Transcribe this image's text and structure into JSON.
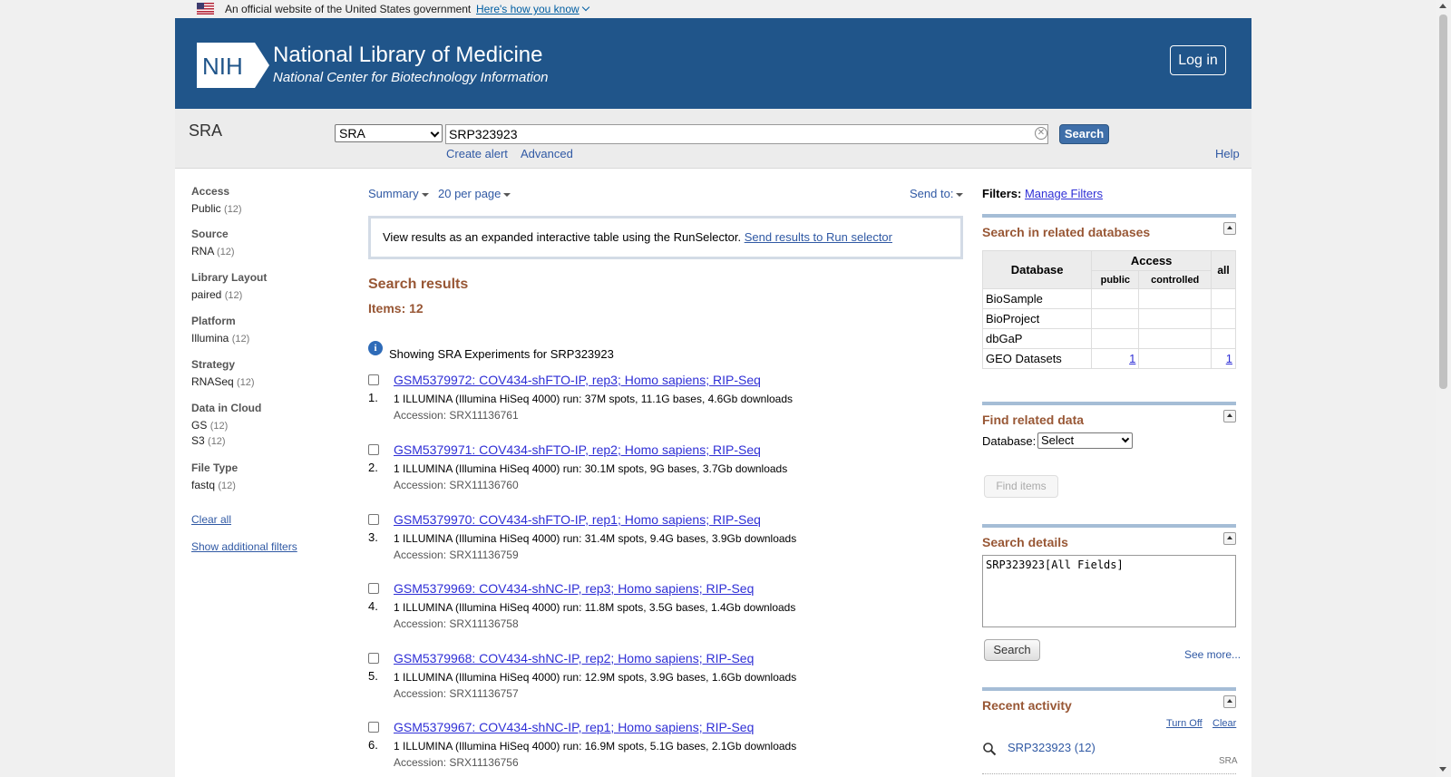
{
  "gov_banner": {
    "text": "An official website of the United States government",
    "link": "Here's how you know"
  },
  "header": {
    "logo_text": "NIH",
    "title": "National Library of Medicine",
    "subtitle": "National Center for Biotechnology Information",
    "login": "Log in"
  },
  "search": {
    "db_label": "SRA",
    "db_select": "SRA",
    "query": "SRP323923",
    "button": "Search",
    "create_alert": "Create alert",
    "advanced": "Advanced",
    "help": "Help"
  },
  "facets": [
    {
      "heading": "Access",
      "values": [
        {
          "label": "Public",
          "count": "(12)"
        }
      ]
    },
    {
      "heading": "Source",
      "values": [
        {
          "label": "RNA",
          "count": "(12)"
        }
      ]
    },
    {
      "heading": "Library Layout",
      "values": [
        {
          "label": "paired",
          "count": "(12)"
        }
      ]
    },
    {
      "heading": "Platform",
      "values": [
        {
          "label": "Illumina",
          "count": "(12)"
        }
      ]
    },
    {
      "heading": "Strategy",
      "values": [
        {
          "label": "RNASeq",
          "count": "(12)"
        }
      ]
    },
    {
      "heading": "Data in Cloud",
      "values": [
        {
          "label": "GS",
          "count": "(12)"
        },
        {
          "label": "S3",
          "count": "(12)"
        }
      ]
    },
    {
      "heading": "File Type",
      "values": [
        {
          "label": "fastq",
          "count": "(12)"
        }
      ]
    }
  ],
  "sidebar_links": {
    "clear_all": "Clear all",
    "show_filters": "Show additional filters"
  },
  "toolbar": {
    "summary": "Summary",
    "per_page": "20 per page",
    "send_to": "Send to:"
  },
  "runselector": {
    "text": "View results as an expanded interactive table using the RunSelector.",
    "link": "Send results to Run selector"
  },
  "results": {
    "heading": "Search results",
    "items": "Items: 12",
    "showing": "Showing SRA Experiments for SRP323923",
    "list": [
      {
        "num": "1.",
        "title": "GSM5379972: COV434-shFTO-IP, rep3; Homo sapiens; RIP-Seq",
        "desc": "1 ILLUMINA (Illumina HiSeq 4000) run: 37M spots, 11.1G bases, 4.6Gb downloads",
        "acc": "Accession: SRX11136761"
      },
      {
        "num": "2.",
        "title": "GSM5379971: COV434-shFTO-IP, rep2; Homo sapiens; RIP-Seq",
        "desc": "1 ILLUMINA (Illumina HiSeq 4000) run: 30.1M spots, 9G bases, 3.7Gb downloads",
        "acc": "Accession: SRX11136760"
      },
      {
        "num": "3.",
        "title": "GSM5379970: COV434-shFTO-IP, rep1; Homo sapiens; RIP-Seq",
        "desc": "1 ILLUMINA (Illumina HiSeq 4000) run: 31.4M spots, 9.4G bases, 3.9Gb downloads",
        "acc": "Accession: SRX11136759"
      },
      {
        "num": "4.",
        "title": "GSM5379969: COV434-shNC-IP, rep3; Homo sapiens; RIP-Seq",
        "desc": "1 ILLUMINA (Illumina HiSeq 4000) run: 11.8M spots, 3.5G bases, 1.4Gb downloads",
        "acc": "Accession: SRX11136758"
      },
      {
        "num": "5.",
        "title": "GSM5379968: COV434-shNC-IP, rep2; Homo sapiens; RIP-Seq",
        "desc": "1 ILLUMINA (Illumina HiSeq 4000) run: 12.9M spots, 3.9G bases, 1.6Gb downloads",
        "acc": "Accession: SRX11136757"
      },
      {
        "num": "6.",
        "title": "GSM5379967: COV434-shNC-IP, rep1; Homo sapiens; RIP-Seq",
        "desc": "1 ILLUMINA (Illumina HiSeq 4000) run: 16.9M spots, 5.1G bases, 2.1Gb downloads",
        "acc": "Accession: SRX11136756"
      }
    ]
  },
  "right": {
    "filters_label": "Filters:",
    "manage_filters": "Manage Filters",
    "related_heading": "Search in related databases",
    "table": {
      "col_db": "Database",
      "col_access": "Access",
      "col_all": "all",
      "col_public": "public",
      "col_controlled": "controlled",
      "rows": [
        {
          "db": "BioSample",
          "public": "",
          "controlled": "",
          "all": ""
        },
        {
          "db": "BioProject",
          "public": "",
          "controlled": "",
          "all": ""
        },
        {
          "db": "dbGaP",
          "public": "",
          "controlled": "",
          "all": ""
        },
        {
          "db": "GEO Datasets",
          "public": "1",
          "controlled": "",
          "all": "1"
        }
      ]
    },
    "find_heading": "Find related data",
    "database_label": "Database:",
    "database_select": "Select",
    "find_items": "Find items",
    "details_heading": "Search details",
    "details_query": "SRP323923[All Fields]",
    "details_search": "Search",
    "see_more": "See more...",
    "recent_heading": "Recent activity",
    "turn_off": "Turn Off",
    "clear": "Clear",
    "recent_item": "SRP323923 (12)",
    "recent_db": "SRA"
  },
  "colors": {
    "header_bg": "#20558a",
    "heading_brown": "#985735",
    "link_blue": "#2f2fd6"
  }
}
